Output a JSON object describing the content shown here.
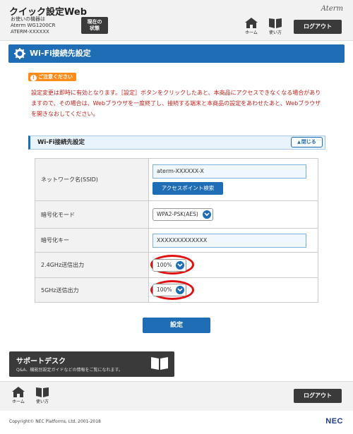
{
  "header": {
    "app_title": "クイック設定Web",
    "device_label": "お使いの機器は",
    "device_model": "Aterm WG1200CR",
    "device_ssid": "ATERM-XXXXXX",
    "status_button": "現在の\n状態",
    "brand": "Aterm",
    "home_label": "ホーム",
    "help_label": "使い方",
    "logout_label": "ログアウト"
  },
  "page_title": "Wi-Fi接続先設定",
  "notice": {
    "badge": "ご注意ください",
    "text": "設定変更は即時に有効となります。［設定］ボタンをクリックしたあと、本商品にアクセスできなくなる場合がありますので、その場合は、Webブラウザを一度終了し、接続する端末と本商品の設定をあわせたあと、Webブラウザを開きなおしてください。"
  },
  "settings": {
    "heading": "Wi-Fi接続先設定",
    "close_label": "閉じる",
    "ssid_label": "ネットワーク名(SSID)",
    "ssid_value": "aterm-XXXXXX-X",
    "ap_search_label": "アクセスポイント検索",
    "encryption_label": "暗号化モード",
    "encryption_value": "WPA2-PSK(AES)",
    "key_label": "暗号化キー",
    "key_value": "XXXXXXXXXXXXX",
    "power24_label": "2.4GHz送信出力",
    "power24_value": "100%",
    "power5_label": "5GHz送信出力",
    "power5_value": "100%"
  },
  "set_button": "設定",
  "support": {
    "title": "サポートデスク",
    "description": "Q&A、機能別設定ガイドなどの情報をご覧になれます。"
  },
  "footer": {
    "home_label": "ホーム",
    "help_label": "使い方",
    "logout_label": "ログアウト",
    "copyright": "Copyright© NEC Platforms, Ltd. 2001-2018",
    "nec": "NEC"
  },
  "colors": {
    "primary": "#1f6db4",
    "dark_button": "#3a3a3a",
    "notice_red": "#c0201c",
    "badge_orange": "#ff8c1a",
    "highlight_ring": "#e01111"
  }
}
